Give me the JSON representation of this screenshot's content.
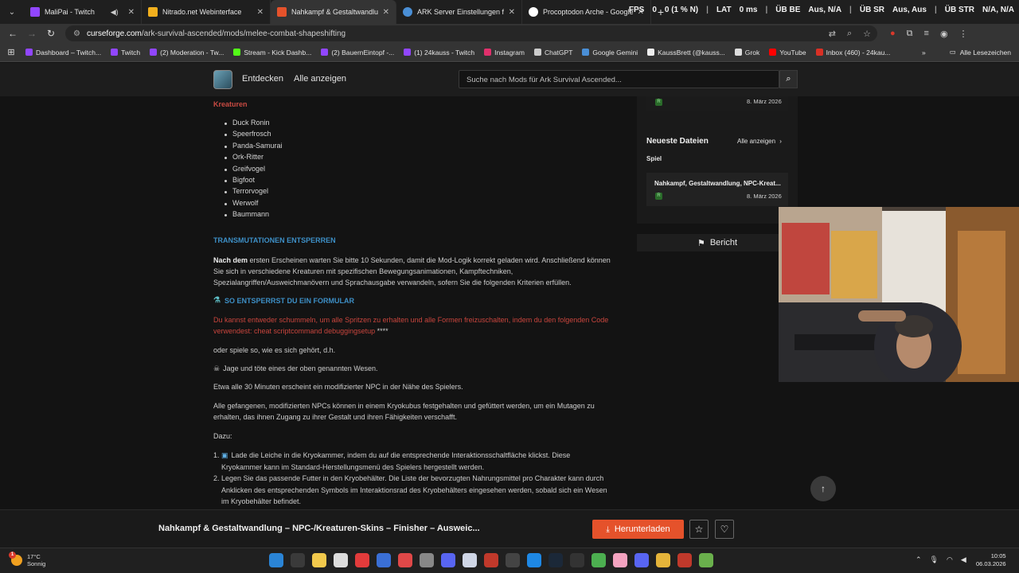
{
  "browser": {
    "tabs": [
      {
        "label": "MaliPai - Twitch",
        "color": "#9146ff"
      },
      {
        "label": "Nitrado.net Webinterface",
        "color": "#f2b01e"
      },
      {
        "label": "Nahkampf & Gestaltwandlung",
        "color": "#e5522b"
      },
      {
        "label": "ARK Server Einstellungen für Ar",
        "color": "#4a8fd6"
      },
      {
        "label": "Procoptodon Arche - Google-S",
        "color": "#ffffff"
      }
    ],
    "url_host": "curseforge.com",
    "url_path": "/ark-survival-ascended/mods/melee-combat-shapeshifting",
    "bookmarks": [
      {
        "label": "Dashboard – Twitch...",
        "color": "#9146ff"
      },
      {
        "label": "Twitch",
        "color": "#9146ff"
      },
      {
        "label": "(2) Moderation - Tw...",
        "color": "#9146ff"
      },
      {
        "label": "Stream - Kick Dashb...",
        "color": "#53fc18"
      },
      {
        "label": "(2) BauernEintopf -...",
        "color": "#9146ff"
      },
      {
        "label": "(1) 24kauss - Twitch",
        "color": "#9146ff"
      },
      {
        "label": "Instagram",
        "color": "#e1306c"
      },
      {
        "label": "ChatGPT",
        "color": "#cccccc"
      },
      {
        "label": "Google Gemini",
        "color": "#4a8fd6"
      },
      {
        "label": "KaussBrett (@kauss...",
        "color": "#eeeeee"
      },
      {
        "label": "Grok",
        "color": "#dddddd"
      },
      {
        "label": "YouTube",
        "color": "#ff0000"
      },
      {
        "label": "Inbox (460) - 24kau...",
        "color": "#d93025"
      }
    ],
    "all_bookmarks": "Alle Lesezeichen"
  },
  "overlay": {
    "fps_label": "FPS",
    "fps_value": "0",
    "loss": "0 (1 % N)",
    "lat_label": "LAT",
    "lat_value": "0 ms",
    "ub_be_label": "ÜB BE",
    "ub_be_value": "Aus, N/A",
    "ub_sr_label": "ÜB SR",
    "ub_sr_value": "Aus, Aus",
    "ub_str_label": "ÜB STR",
    "ub_str_value": "N/A, N/A"
  },
  "site": {
    "nav_discover": "Entdecken",
    "nav_all": "Alle anzeigen",
    "search_placeholder": "Suche nach Mods für Ark Survival Ascended..."
  },
  "article": {
    "creatures_heading": "Kreaturen",
    "creatures": [
      "Duck Ronin",
      "Speerfrosch",
      "Panda-Samurai",
      "Ork-Ritter",
      "Greifvogel",
      "Bigfoot",
      "Terrorvogel",
      "Werwolf",
      "Baummann"
    ],
    "unlock_heading": "TRANSMUTATIONEN ENTSPERREN",
    "intro_bold": "Nach dem",
    "intro_rest": " ersten Erscheinen warten Sie bitte 10 Sekunden, damit die Mod-Logik korrekt geladen wird. Anschließend können Sie sich in verschiedene Kreaturen mit spezifischen Bewegungsanimationen, Kampftechniken, Spezialangriffen/Ausweichmanövern und Sprachausgabe verwandeln, sofern Sie die folgenden Kriterien erfüllen.",
    "formula_heading": "SO ENTSPERRST DU EIN FORMULAR",
    "cheat_text": "Du kannst entweder schummeln, um alle Spritzen zu erhalten und alle Formen freizuschalten, indem du den folgenden Code verwendest: cheat scriptcommand debuggingsetup",
    "cheat_suffix": " ****",
    "or_text": "oder spiele so, wie es sich gehört, d.h.",
    "hunt_text": "Jage und töte eines der oben genannten Wesen.",
    "spawn_text": "Etwa alle 30 Minuten erscheint ein modifizierter NPC in der Nähe des Spielers.",
    "captured_text": "Alle gefangenen, modifizierten NPCs können in einem Kryokubus festgehalten und gefüttert werden, um ein Mutagen zu erhalten, das ihnen Zugang zu ihrer Gestalt und ihren Fähigkeiten verschafft.",
    "dazu": "Dazu:",
    "steps": [
      {
        "num": "1.",
        "text": "Lade die Leiche in die Kryokammer, indem du auf die entsprechende Interaktionsschaltfläche klickst. Diese Kryokammer kann im Standard-Herstellungsmenü des Spielers hergestellt werden."
      },
      {
        "num": "2.",
        "text": "Legen Sie das passende Futter in den Kryobehälter. Die Liste der bevorzugten Nahrungsmittel pro Charakter kann durch Anklicken des entsprechenden Symbols im Interaktionsrad des Kryobehälters eingesehen werden, sobald sich ein Wesen im Kryobehälter befindet."
      }
    ]
  },
  "sidebar": {
    "top_badge": "R",
    "top_date": "8. März 2026",
    "newest_title": "Neueste Dateien",
    "show_all": "Alle anzeigen",
    "game_label": "Spiel",
    "file_title": "Nahkampf, Gestaltwandlung, NPC-Kreat...",
    "file_badge": "R",
    "file_date": "8. März 2026",
    "report": "Bericht"
  },
  "footer": {
    "title": "Nahkampf & Gestaltwandlung – NPC-/Kreaturen-Skins – Finisher – Ausweic...",
    "download": "Herunterladen"
  },
  "taskbar": {
    "temp": "17°C",
    "weather": "Sonnig",
    "badge": "1",
    "time": "10:05",
    "date": "06.03.2026"
  }
}
